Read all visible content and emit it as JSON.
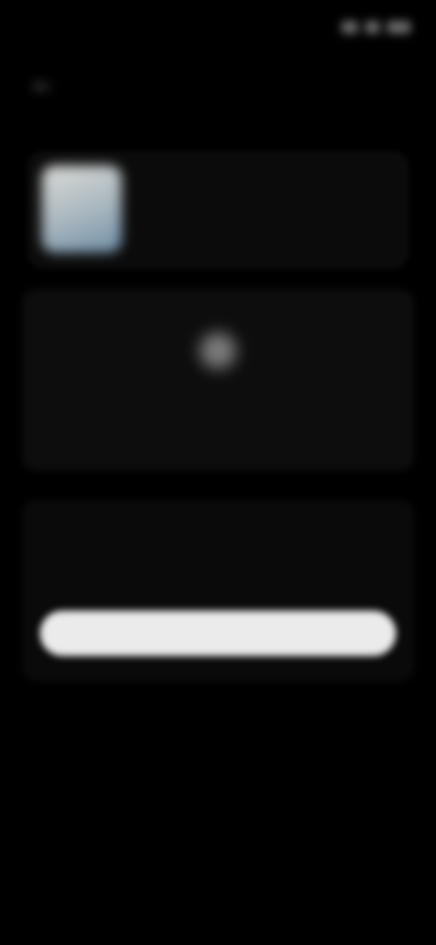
{
  "status_bar": {
    "time": "",
    "icons": [
      "signal-icon",
      "wifi-icon",
      "battery-icon"
    ]
  },
  "header": {
    "back_icon": "arrow-left-icon",
    "title": ""
  },
  "app": {
    "name": "",
    "developer": "",
    "meta": ""
  },
  "info": {
    "icon": "info-icon",
    "title": "",
    "text": ""
  },
  "section": {
    "heading": "",
    "subtext": "",
    "button_label": ""
  },
  "colors": {
    "background": "#000000",
    "card": "#0b0b0b",
    "button": "#ebebeb"
  }
}
